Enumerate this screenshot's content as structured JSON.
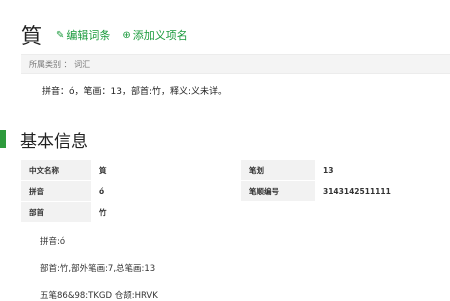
{
  "header": {
    "term": "筫",
    "edit_label": "编辑词条",
    "add_label": "添加义项名"
  },
  "category": {
    "text": "所属类别 ： 词汇"
  },
  "summary": "拼音：ó，笔画：13，部首:竹，释义:义未详。",
  "section": {
    "title": "基本信息"
  },
  "info_table": {
    "rows": [
      {
        "k1": "中文名称",
        "v1": "筫",
        "k2": "笔划",
        "v2": "13"
      },
      {
        "k1": "拼音",
        "v1": "ó",
        "k2": "笔顺编号",
        "v2": "3143142511111"
      },
      {
        "k1": "部首",
        "v1": "竹",
        "k2": "",
        "v2": ""
      }
    ]
  },
  "details": {
    "line1": "拼音:ó",
    "line2": "部首:竹,部外笔画:7,总笔画:13",
    "line3": "五笔86&98:TKGD 仓颉:HRVK"
  },
  "colors": {
    "accent_green": "#1a9a3c",
    "section_bar": "#2d9a3c"
  },
  "icons": {
    "edit": "pencil-icon",
    "add": "add-entry-icon"
  }
}
